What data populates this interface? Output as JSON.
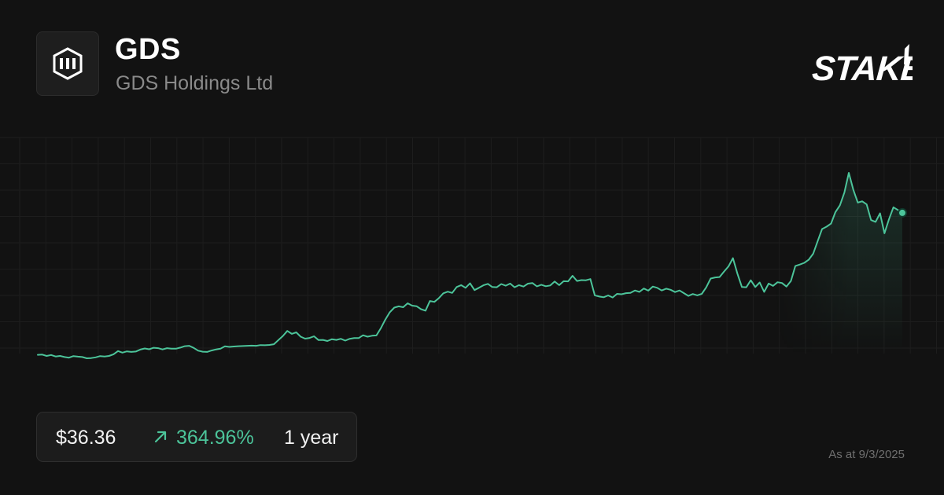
{
  "header": {
    "ticker": "GDS",
    "company": "GDS Holdings Ltd",
    "logo_icon": "gds-logo-icon",
    "brand": "STAKE"
  },
  "stats": {
    "price": "$36.36",
    "change": "364.96%",
    "change_icon": "arrow-up-right-icon",
    "period": "1 year"
  },
  "footer": {
    "as_at": "As at 9/3/2025"
  },
  "colors": {
    "background": "#121212",
    "line": "#4cc49a",
    "grid": "#1d1d1d"
  },
  "chart_data": {
    "type": "line",
    "xlabel": "",
    "ylabel": "",
    "grid": true,
    "series": [
      {
        "values": [
          7.82,
          7.87,
          7.6,
          7.78,
          7.49,
          7.6,
          7.38,
          7.24,
          7.56,
          7.45,
          7.38,
          7.12,
          7.16,
          7.31,
          7.56,
          7.49,
          7.6,
          7.93,
          8.58,
          8.26,
          8.51,
          8.4,
          8.48,
          8.87,
          9.09,
          8.94,
          9.23,
          9.16,
          8.91,
          9.16,
          9.05,
          9.05,
          9.27,
          9.56,
          9.63,
          9.2,
          8.66,
          8.44,
          8.4,
          8.69,
          8.91,
          9.05,
          9.52,
          9.41,
          9.49,
          9.56,
          9.59,
          9.63,
          9.66,
          9.63,
          9.77,
          9.74,
          9.81,
          9.95,
          10.78,
          11.61,
          12.61,
          12.04,
          12.33,
          11.47,
          11.07,
          11.21,
          11.54,
          10.78,
          10.82,
          10.6,
          10.96,
          10.82,
          11.03,
          10.67,
          11.03,
          11.18,
          11.18,
          11.75,
          11.47,
          11.65,
          11.72,
          13.19,
          14.92,
          16.38,
          17.31,
          17.56,
          17.38,
          18.17,
          17.71,
          17.6,
          16.99,
          16.7,
          18.64,
          18.46,
          19.21,
          20.18,
          20.51,
          20.26,
          21.44,
          21.83,
          21.29,
          22.19,
          20.83,
          21.29,
          21.8,
          22.08,
          21.44,
          21.4,
          22.05,
          21.72,
          22.15,
          21.4,
          21.83,
          21.54,
          22.12,
          22.26,
          21.58,
          21.9,
          21.61,
          21.76,
          22.55,
          21.83,
          22.62,
          22.58,
          23.7,
          22.66,
          22.83,
          22.8,
          23.05,
          19.78,
          19.53,
          19.39,
          19.75,
          19.35,
          20.07,
          20.0,
          20.22,
          20.26,
          20.76,
          20.47,
          21.15,
          20.72,
          21.54,
          21.29,
          20.76,
          21.11,
          20.9,
          20.43,
          20.76,
          20.22,
          19.67,
          20.04,
          19.78,
          20.07,
          21.37,
          23.16,
          23.38,
          23.45,
          24.56,
          25.6,
          27.26,
          24.13,
          21.44,
          21.4,
          22.8,
          21.44,
          22.37,
          20.47,
          22.15,
          21.69,
          22.41,
          22.26,
          21.54,
          22.66,
          25.67,
          25.96,
          26.32,
          26.93,
          28.15,
          30.67,
          33.11,
          33.58,
          34.19,
          36.52,
          37.88,
          40.47,
          44.4,
          41.02,
          38.43,
          38.68,
          38.07,
          34.9,
          34.55,
          36.27,
          32.26,
          35.05,
          37.48,
          36.95,
          36.36
        ]
      }
    ]
  }
}
